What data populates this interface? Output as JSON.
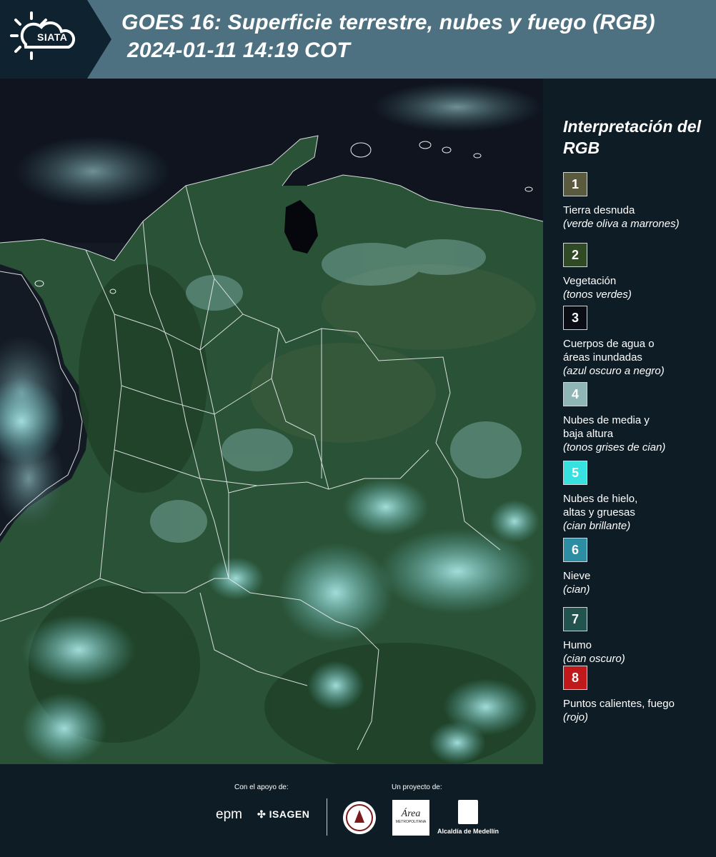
{
  "header": {
    "logo_text": "SIATA",
    "title_line1": "GOES 16: Superficie terrestre, nubes y fuego (RGB)",
    "title_line2": "2024-01-11 14:19 COT",
    "bg_color": "#4d7180",
    "logo_bg_color": "#0f2230"
  },
  "legend": {
    "title": "Interpretación del RGB",
    "items": [
      {
        "number": "1",
        "label": "Tierra desnuda",
        "desc": "(verde oliva a marrones)",
        "color": "#5a5a3e"
      },
      {
        "number": "2",
        "label": "Vegetación",
        "desc": "(tonos verdes)",
        "color": "#2f4a25"
      },
      {
        "number": "3",
        "label": "Cuerpos de agua o\náreas inundadas",
        "desc": "(azul oscuro a negro)",
        "color": "#0a0d14"
      },
      {
        "number": "4",
        "label": "Nubes de media y\nbaja altura",
        "desc": "(tonos grises de cian)",
        "color": "#8fb5b6"
      },
      {
        "number": "5",
        "label": "Nubes de hielo,\naltas y gruesas",
        "desc": "(cian brillante)",
        "color": "#36e1df"
      },
      {
        "number": "6",
        "label": "Nieve",
        "desc": "(cian)",
        "color": "#2d8da3"
      },
      {
        "number": "7",
        "label": "Humo",
        "desc": "(cian oscuro)",
        "color": "#23534f"
      },
      {
        "number": "8",
        "label": "Puntos calientes, fuego",
        "desc": "(rojo)",
        "color": "#c0191b"
      }
    ]
  },
  "footer": {
    "support_label": "Con el apoyo de:",
    "project_label": "Un proyecto de:",
    "epm_logo": "epm",
    "isagen_logo": "ISAGEN",
    "area_logo_script": "Área",
    "area_logo_small": "METROPOLITANA",
    "alcaldia_label": "Alcaldía de Medellín"
  },
  "map": {
    "description_colors": {
      "ocean": "#141a24",
      "land": "#2a5236",
      "clouds": "#8fd3d3"
    }
  }
}
